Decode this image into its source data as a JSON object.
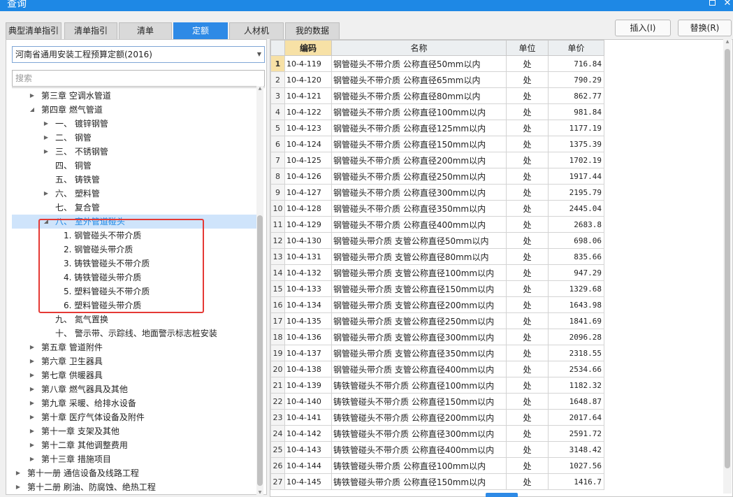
{
  "window": {
    "title": "查询",
    "maximize_icon": "maximize-icon",
    "close_icon": "close-icon"
  },
  "tabs": [
    {
      "label": "典型清单指引",
      "active": false
    },
    {
      "label": "清单指引",
      "active": false
    },
    {
      "label": "清单",
      "active": false
    },
    {
      "label": "定额",
      "active": true
    },
    {
      "label": "人材机",
      "active": false
    },
    {
      "label": "我的数据",
      "active": false
    }
  ],
  "actions": {
    "insert": "插入(I)",
    "replace": "替换(R)"
  },
  "left": {
    "select_value": "河南省通用安装工程预算定额(2016)",
    "search_placeholder": "搜索",
    "tree": [
      {
        "label": "第三章 空调水管道",
        "indent": 1,
        "toggle": "right",
        "selected": false
      },
      {
        "label": "第四章 燃气管道",
        "indent": 1,
        "toggle": "down",
        "selected": false
      },
      {
        "label": "一、 镀锌钢管",
        "indent": 2,
        "toggle": "right",
        "selected": false
      },
      {
        "label": "二、 钢管",
        "indent": 2,
        "toggle": "right",
        "selected": false
      },
      {
        "label": "三、 不锈钢管",
        "indent": 2,
        "toggle": "right",
        "selected": false
      },
      {
        "label": "四、 铜管",
        "indent": 2,
        "toggle": "none",
        "selected": false
      },
      {
        "label": "五、 铸铁管",
        "indent": 2,
        "toggle": "none",
        "selected": false
      },
      {
        "label": "六、 塑料管",
        "indent": 2,
        "toggle": "right",
        "selected": false
      },
      {
        "label": "七、 复合管",
        "indent": 2,
        "toggle": "none",
        "selected": false
      },
      {
        "label": "八、 室外管道碰头",
        "indent": 2,
        "toggle": "down",
        "selected": true
      },
      {
        "label": "1. 钢管碰头不带介质",
        "indent": 3,
        "toggle": "none",
        "selected": false
      },
      {
        "label": "2. 钢管碰头带介质",
        "indent": 3,
        "toggle": "none",
        "selected": false
      },
      {
        "label": "3. 铸铁管碰头不带介质",
        "indent": 3,
        "toggle": "none",
        "selected": false
      },
      {
        "label": "4. 铸铁管碰头带介质",
        "indent": 3,
        "toggle": "none",
        "selected": false
      },
      {
        "label": "5. 塑料管碰头不带介质",
        "indent": 3,
        "toggle": "none",
        "selected": false
      },
      {
        "label": "6. 塑料管碰头带介质",
        "indent": 3,
        "toggle": "none",
        "selected": false
      },
      {
        "label": "九、 氮气置换",
        "indent": 2,
        "toggle": "none",
        "selected": false
      },
      {
        "label": "十、 警示带、示踪线、地面警示标志桩安装",
        "indent": 2,
        "toggle": "none",
        "selected": false
      },
      {
        "label": "第五章 管道附件",
        "indent": 1,
        "toggle": "right",
        "selected": false
      },
      {
        "label": "第六章 卫生器具",
        "indent": 1,
        "toggle": "right",
        "selected": false
      },
      {
        "label": "第七章 供暖器具",
        "indent": 1,
        "toggle": "right",
        "selected": false
      },
      {
        "label": "第八章 燃气器具及其他",
        "indent": 1,
        "toggle": "right",
        "selected": false
      },
      {
        "label": "第九章 采暖、给排水设备",
        "indent": 1,
        "toggle": "right",
        "selected": false
      },
      {
        "label": "第十章 医疗气体设备及附件",
        "indent": 1,
        "toggle": "right",
        "selected": false
      },
      {
        "label": "第十一章 支架及其他",
        "indent": 1,
        "toggle": "right",
        "selected": false
      },
      {
        "label": "第十二章 其他调整费用",
        "indent": 1,
        "toggle": "right",
        "selected": false
      },
      {
        "label": "第十三章 措施项目",
        "indent": 1,
        "toggle": "right",
        "selected": false
      },
      {
        "label": "第十一册 通信设备及线路工程",
        "indent": 0,
        "toggle": "right",
        "selected": false
      },
      {
        "label": "第十二册 刷油、防腐蚀、绝热工程",
        "indent": 0,
        "toggle": "right",
        "selected": false
      }
    ]
  },
  "grid": {
    "columns": {
      "code": "编码",
      "name": "名称",
      "unit": "单位",
      "price": "单价"
    },
    "rows": [
      {
        "n": "1",
        "code": "10-4-119",
        "name": "钢管碰头不带介质 公称直径50mm以内",
        "unit": "处",
        "price": "716.84"
      },
      {
        "n": "2",
        "code": "10-4-120",
        "name": "钢管碰头不带介质 公称直径65mm以内",
        "unit": "处",
        "price": "790.29"
      },
      {
        "n": "3",
        "code": "10-4-121",
        "name": "钢管碰头不带介质 公称直径80mm以内",
        "unit": "处",
        "price": "862.77"
      },
      {
        "n": "4",
        "code": "10-4-122",
        "name": "钢管碰头不带介质 公称直径100mm以内",
        "unit": "处",
        "price": "981.84"
      },
      {
        "n": "5",
        "code": "10-4-123",
        "name": "钢管碰头不带介质 公称直径125mm以内",
        "unit": "处",
        "price": "1177.19"
      },
      {
        "n": "6",
        "code": "10-4-124",
        "name": "钢管碰头不带介质 公称直径150mm以内",
        "unit": "处",
        "price": "1375.39"
      },
      {
        "n": "7",
        "code": "10-4-125",
        "name": "钢管碰头不带介质 公称直径200mm以内",
        "unit": "处",
        "price": "1702.19"
      },
      {
        "n": "8",
        "code": "10-4-126",
        "name": "钢管碰头不带介质 公称直径250mm以内",
        "unit": "处",
        "price": "1917.44"
      },
      {
        "n": "9",
        "code": "10-4-127",
        "name": "钢管碰头不带介质 公称直径300mm以内",
        "unit": "处",
        "price": "2195.79"
      },
      {
        "n": "10",
        "code": "10-4-128",
        "name": "钢管碰头不带介质 公称直径350mm以内",
        "unit": "处",
        "price": "2445.04"
      },
      {
        "n": "11",
        "code": "10-4-129",
        "name": "钢管碰头不带介质 公称直径400mm以内",
        "unit": "处",
        "price": "2683.8"
      },
      {
        "n": "12",
        "code": "10-4-130",
        "name": "钢管碰头带介质 支管公称直径50mm以内",
        "unit": "处",
        "price": "698.06"
      },
      {
        "n": "13",
        "code": "10-4-131",
        "name": "钢管碰头带介质 支管公称直径80mm以内",
        "unit": "处",
        "price": "835.66"
      },
      {
        "n": "14",
        "code": "10-4-132",
        "name": "钢管碰头带介质 支管公称直径100mm以内",
        "unit": "处",
        "price": "947.29"
      },
      {
        "n": "15",
        "code": "10-4-133",
        "name": "钢管碰头带介质 支管公称直径150mm以内",
        "unit": "处",
        "price": "1329.68"
      },
      {
        "n": "16",
        "code": "10-4-134",
        "name": "钢管碰头带介质 支管公称直径200mm以内",
        "unit": "处",
        "price": "1643.98"
      },
      {
        "n": "17",
        "code": "10-4-135",
        "name": "钢管碰头带介质 支管公称直径250mm以内",
        "unit": "处",
        "price": "1841.69"
      },
      {
        "n": "18",
        "code": "10-4-136",
        "name": "钢管碰头带介质 支管公称直径300mm以内",
        "unit": "处",
        "price": "2096.28"
      },
      {
        "n": "19",
        "code": "10-4-137",
        "name": "钢管碰头带介质 支管公称直径350mm以内",
        "unit": "处",
        "price": "2318.55"
      },
      {
        "n": "20",
        "code": "10-4-138",
        "name": "钢管碰头带介质 支管公称直径400mm以内",
        "unit": "处",
        "price": "2534.66"
      },
      {
        "n": "21",
        "code": "10-4-139",
        "name": "铸铁管碰头不带介质 公称直径100mm以内",
        "unit": "处",
        "price": "1182.32"
      },
      {
        "n": "22",
        "code": "10-4-140",
        "name": "铸铁管碰头不带介质 公称直径150mm以内",
        "unit": "处",
        "price": "1648.87"
      },
      {
        "n": "23",
        "code": "10-4-141",
        "name": "铸铁管碰头不带介质 公称直径200mm以内",
        "unit": "处",
        "price": "2017.64"
      },
      {
        "n": "24",
        "code": "10-4-142",
        "name": "铸铁管碰头不带介质 公称直径300mm以内",
        "unit": "处",
        "price": "2591.72"
      },
      {
        "n": "25",
        "code": "10-4-143",
        "name": "铸铁管碰头不带介质 公称直径400mm以内",
        "unit": "处",
        "price": "3148.42"
      },
      {
        "n": "26",
        "code": "10-4-144",
        "name": "铸铁管碰头带介质 公称直径100mm以内",
        "unit": "处",
        "price": "1027.56"
      },
      {
        "n": "27",
        "code": "10-4-145",
        "name": "铸铁管碰头带介质 公称直径150mm以内",
        "unit": "处",
        "price": "1416.7"
      }
    ]
  }
}
